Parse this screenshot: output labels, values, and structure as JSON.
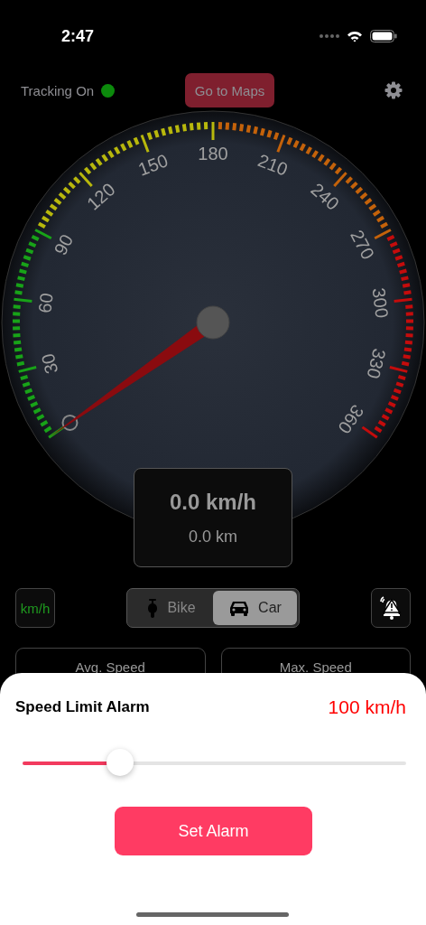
{
  "status_bar": {
    "time": "2:47"
  },
  "top_bar": {
    "tracking_label": "Tracking On",
    "tracking_on": true,
    "maps_button": "Go to Maps"
  },
  "gauge": {
    "zones": [
      {
        "color": "#18a318"
      },
      {
        "color": "#b8b80c"
      },
      {
        "color": "#c4620a"
      },
      {
        "color": "#c40c0c"
      }
    ],
    "labels": [
      "30",
      "60",
      "90",
      "120",
      "150",
      "180",
      "210",
      "240",
      "270",
      "300",
      "330",
      "360"
    ]
  },
  "readout": {
    "speed": "0.0 km/h",
    "distance": "0.0 km"
  },
  "unit_button": "km/h",
  "vehicle_tabs": [
    {
      "label": "Bike",
      "kind": "bike",
      "selected": false
    },
    {
      "label": "Car",
      "kind": "car",
      "selected": true
    }
  ],
  "stats": [
    {
      "label": "Avg. Speed"
    },
    {
      "label": "Max. Speed"
    }
  ],
  "alarm_sheet": {
    "title": "Speed Limit Alarm",
    "value": "100 km/h",
    "slider": {
      "level": 0.255
    },
    "button": "Set Alarm"
  }
}
